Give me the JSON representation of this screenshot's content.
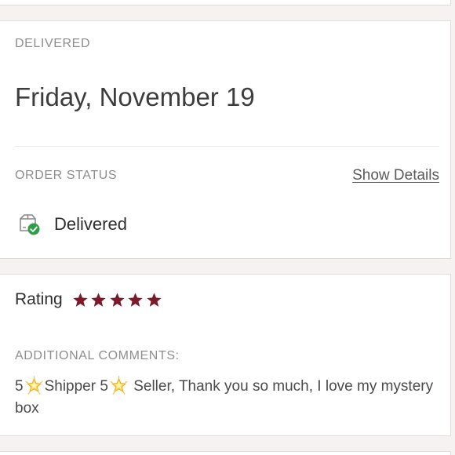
{
  "delivery": {
    "label": "DELIVERED",
    "date": "Friday, November 19"
  },
  "order_status": {
    "label": "ORDER STATUS",
    "show_details": "Show Details",
    "status_icon": "package-delivered-icon",
    "status": "Delivered"
  },
  "rating": {
    "title": "Rating",
    "stars": 5,
    "star_color": "#7a1a2a"
  },
  "comments": {
    "label": "ADDITIONAL COMMENTS:",
    "parts": [
      "5",
      "Shipper 5",
      " Seller, Thank you so much, I love my mystery box"
    ],
    "emoji": "glowing-star-emoji"
  },
  "colors": {
    "background": "#f7f2f2",
    "card": "#ffffff",
    "label": "#8f8c8c",
    "text": "#3a3a3a",
    "success": "#2f9e48"
  }
}
